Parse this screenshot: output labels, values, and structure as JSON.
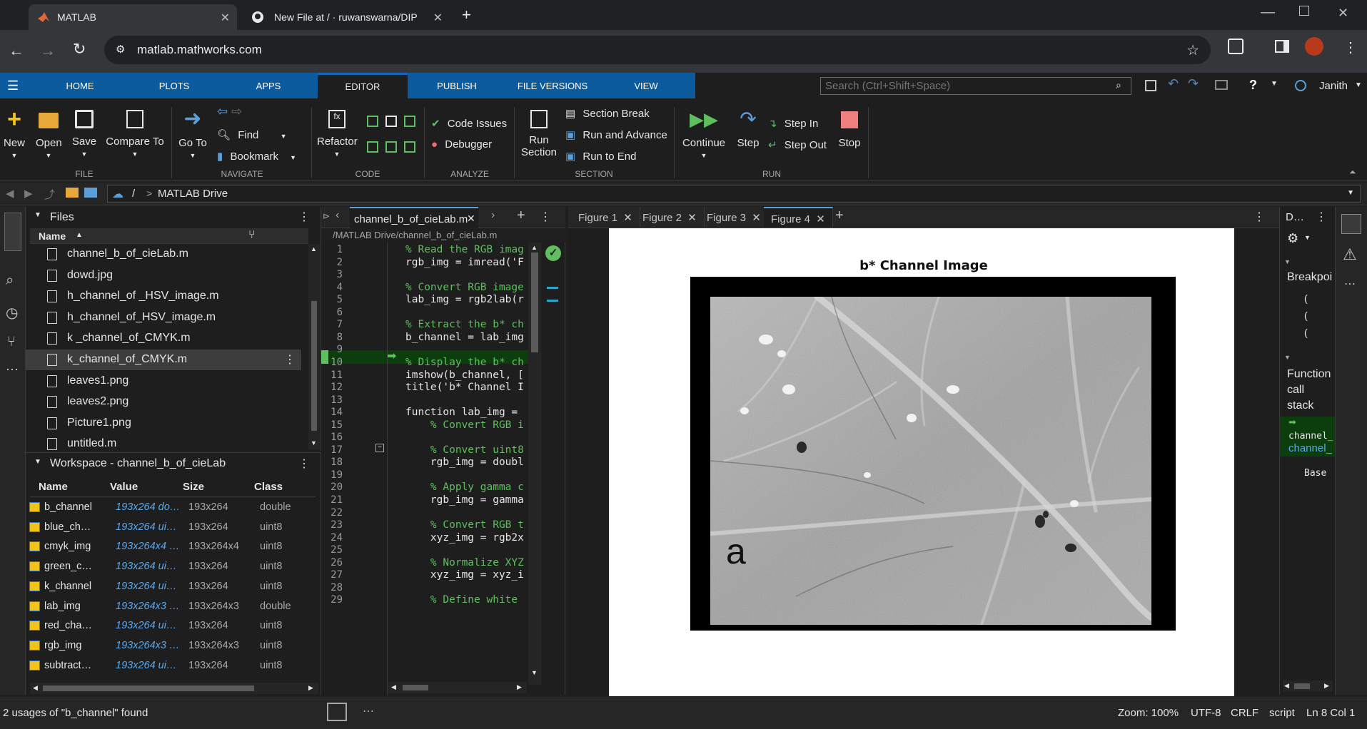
{
  "browser": {
    "tabs": [
      {
        "title": "MATLAB"
      },
      {
        "title": "New File at / · ruwanswarna/DIP"
      }
    ],
    "url": "matlab.mathworks.com"
  },
  "toolstrip": {
    "tabs": [
      "HOME",
      "PLOTS",
      "APPS",
      "EDITOR",
      "PUBLISH",
      "FILE VERSIONS",
      "VIEW"
    ],
    "search_placeholder": "Search (Ctrl+Shift+Space)",
    "user": "Janith",
    "file": {
      "new": "New",
      "open": "Open",
      "save": "Save",
      "compare": "Compare To",
      "group": "FILE"
    },
    "navigate": {
      "goto": "Go To",
      "find": "Find",
      "bookmark": "Bookmark",
      "group": "NAVIGATE"
    },
    "code": {
      "refactor": "Refactor",
      "group": "CODE"
    },
    "analyze": {
      "code_issues": "Code Issues",
      "debugger": "Debugger",
      "group": "ANALYZE"
    },
    "section": {
      "run_section_1": "Run",
      "run_section_2": "Section",
      "section_break": "Section Break",
      "run_advance": "Run and Advance",
      "run_end": "Run to End",
      "group": "SECTION"
    },
    "run": {
      "continue": "Continue",
      "step": "Step",
      "step_in": "Step In",
      "step_out": "Step Out",
      "stop": "Stop",
      "group": "RUN"
    }
  },
  "pathbar": {
    "sep": "/",
    "sep2": ">",
    "folder": "MATLAB Drive"
  },
  "files": {
    "title": "Files",
    "column": "Name",
    "items": [
      "channel_b_of_cieLab.m",
      "dowd.jpg",
      "h_channel_of _HSV_image.m",
      "h_channel_of_HSV_image.m",
      "k _channel_of_CMYK.m",
      "k_channel_of_CMYK.m",
      "leaves1.png",
      "leaves2.png",
      "Picture1.png",
      "untitled.m"
    ]
  },
  "workspace": {
    "title": "Workspace - channel_b_of_cieLab",
    "columns": [
      "Name",
      "Value",
      "Size",
      "Class"
    ],
    "rows": [
      [
        "b_channel",
        "193x264 do…",
        "193x264",
        "double"
      ],
      [
        "blue_ch…",
        "193x264 ui…",
        "193x264",
        "uint8"
      ],
      [
        "cmyk_img",
        "193x264x4 …",
        "193x264x4",
        "uint8"
      ],
      [
        "green_c…",
        "193x264 ui…",
        "193x264",
        "uint8"
      ],
      [
        "k_channel",
        "193x264 ui…",
        "193x264",
        "uint8"
      ],
      [
        "lab_img",
        "193x264x3 …",
        "193x264x3",
        "double"
      ],
      [
        "red_cha…",
        "193x264 ui…",
        "193x264",
        "uint8"
      ],
      [
        "rgb_img",
        "193x264x3 …",
        "193x264x3",
        "uint8"
      ],
      [
        "subtract…",
        "193x264 ui…",
        "193x264",
        "uint8"
      ]
    ]
  },
  "editor": {
    "tab": "channel_b_of_cieLab.m",
    "path": "/MATLAB Drive/channel_b_of_cieLab.m",
    "lines": [
      {
        "n": "1",
        "t": "% Read the RGB imag",
        "k": "cmt"
      },
      {
        "n": "2",
        "t": "rgb_img = imread('F",
        "k": "code"
      },
      {
        "n": "3",
        "t": "",
        "k": "code"
      },
      {
        "n": "4",
        "t": "% Convert RGB image",
        "k": "cmt"
      },
      {
        "n": "5",
        "t": "lab_img = rgb2lab(r",
        "k": "code"
      },
      {
        "n": "6",
        "t": "",
        "k": "code"
      },
      {
        "n": "7",
        "t": "% Extract the b* ch",
        "k": "cmt"
      },
      {
        "n": "8",
        "t": "b_channel = lab_img",
        "k": "code"
      },
      {
        "n": "9",
        "t": "",
        "k": "code"
      },
      {
        "n": "10",
        "t": "% Display the b* ch",
        "k": "cmt"
      },
      {
        "n": "11",
        "t": "imshow(b_channel, [",
        "k": "code"
      },
      {
        "n": "12",
        "t": "title('b* Channel I",
        "k": "code"
      },
      {
        "n": "13",
        "t": "",
        "k": "code"
      },
      {
        "n": "14",
        "t": "function lab_img = ",
        "k": "code"
      },
      {
        "n": "15",
        "t": "    % Convert RGB i",
        "k": "cmt"
      },
      {
        "n": "16",
        "t": "",
        "k": "code"
      },
      {
        "n": "17",
        "t": "    % Convert uint8",
        "k": "cmt"
      },
      {
        "n": "18",
        "t": "    rgb_img = doubl",
        "k": "code"
      },
      {
        "n": "19",
        "t": "",
        "k": "code"
      },
      {
        "n": "20",
        "t": "    % Apply gamma c",
        "k": "cmt"
      },
      {
        "n": "21",
        "t": "    rgb_img = gamma",
        "k": "code"
      },
      {
        "n": "22",
        "t": "",
        "k": "code"
      },
      {
        "n": "23",
        "t": "    % Convert RGB t",
        "k": "cmt"
      },
      {
        "n": "24",
        "t": "    xyz_img = rgb2x",
        "k": "code"
      },
      {
        "n": "25",
        "t": "",
        "k": "code"
      },
      {
        "n": "26",
        "t": "    % Normalize XYZ",
        "k": "cmt"
      },
      {
        "n": "27",
        "t": "    xyz_img = xyz_i",
        "k": "code"
      },
      {
        "n": "28",
        "t": "",
        "k": "code"
      },
      {
        "n": "29",
        "t": "    % Define white ",
        "k": "cmt"
      }
    ]
  },
  "figures": {
    "tabs": [
      "Figure 1",
      "Figure 2",
      "Figure 3",
      "Figure 4"
    ],
    "title": "b* Channel Image",
    "label": "a"
  },
  "debug": {
    "tab": "D…",
    "breakpoints": "Breakpoi",
    "function_call_stack": [
      "Function",
      "call",
      "stack"
    ],
    "stack_item_1": "channel_",
    "stack_item_2": "channel_",
    "base": "Base"
  },
  "status": {
    "message": "2 usages of \"b_channel\" found",
    "zoom": "Zoom: 100%",
    "encoding": "UTF-8",
    "eol": "CRLF",
    "type": "script",
    "position": "Ln 8 Col 1"
  },
  "colors": {
    "accent": "#0c5b9e",
    "comment": "#5fbf5f",
    "highlight_line": "#0c3d0c"
  }
}
